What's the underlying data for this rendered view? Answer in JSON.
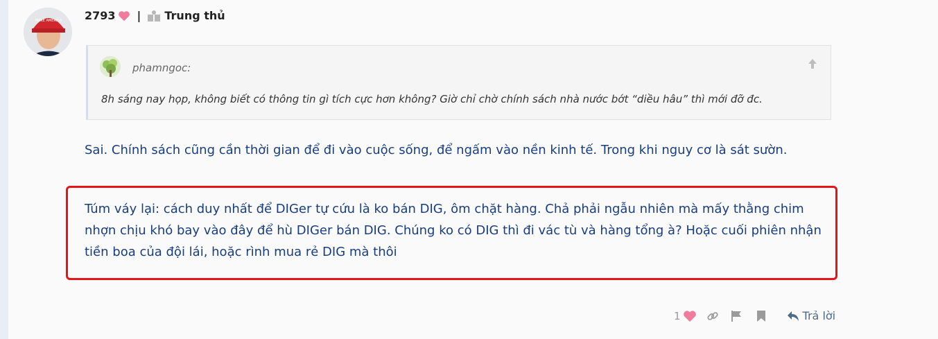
{
  "user": {
    "points": "2793",
    "rank": "Trung thủ"
  },
  "quote": {
    "author": "phamngoc:",
    "text": "8h sáng nay họp, không biết có thông tin gì tích cực hơn không? Giờ chỉ chờ chính sách nhà nước bớt “diều hâu” thì mới đỡ đc."
  },
  "post": {
    "paragraph1": "Sai. Chính sách cũng cần thời gian để đi vào cuộc sống, để ngấm vào nền kinh tế. Trong khi nguy cơ là sát sườn.",
    "paragraph2": "Túm váy lại: cách duy nhất để DIGer tự cứu là ko bán DIG, ôm chặt hàng. Chả phải ngẫu nhiên mà mấy thằng chim nhợn chịu khó bay vào đây để hù DIGer bán DIG. Chúng ko có DIG thì đi vác tù và hàng tổng à? Hoặc cuối phiên nhận tiền boa của đội lái, hoặc rình mua rẻ DIG mà thôi"
  },
  "actions": {
    "like_count": "1",
    "reply_label": "Trả lời"
  },
  "colors": {
    "text_blue": "#183d80",
    "heart": "#f07c9c",
    "highlight_border": "#e3141a"
  },
  "icons": [
    "heart-icon",
    "rank-icon",
    "up-arrow-icon",
    "link-icon",
    "flag-icon",
    "bookmark-icon",
    "reply-icon"
  ]
}
